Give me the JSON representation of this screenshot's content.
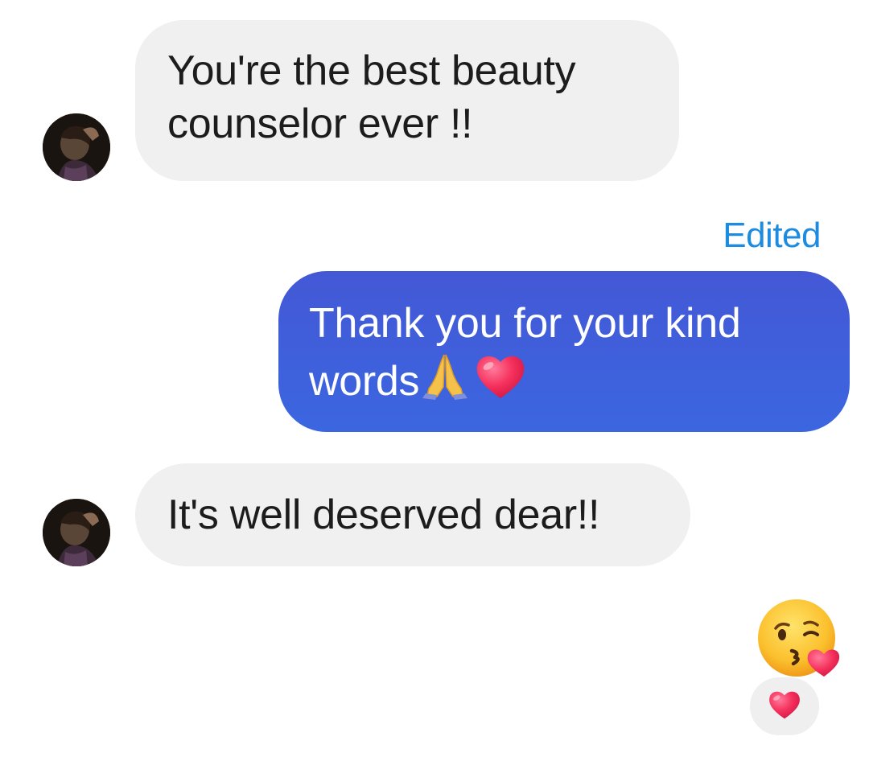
{
  "conversation": {
    "messages": [
      {
        "direction": "incoming",
        "lines": [
          "You're the best beauty",
          "counselor ever !!"
        ]
      },
      {
        "direction": "outgoing",
        "status": "Edited",
        "lines": [
          "Thank you for your kind",
          "words"
        ],
        "inline_emojis": [
          "folded-hands",
          "red-heart"
        ]
      },
      {
        "direction": "incoming",
        "lines": [
          "It's well deserved dear!!"
        ]
      }
    ],
    "sticker_emoji": "face-blowing-a-kiss",
    "reaction": "red-heart"
  },
  "colors": {
    "incoming_bubble": "#f0f0f0",
    "outgoing_bubble": "#4060dc",
    "edited_label": "#1d8ce0",
    "text_dark": "#1c1c1c"
  }
}
